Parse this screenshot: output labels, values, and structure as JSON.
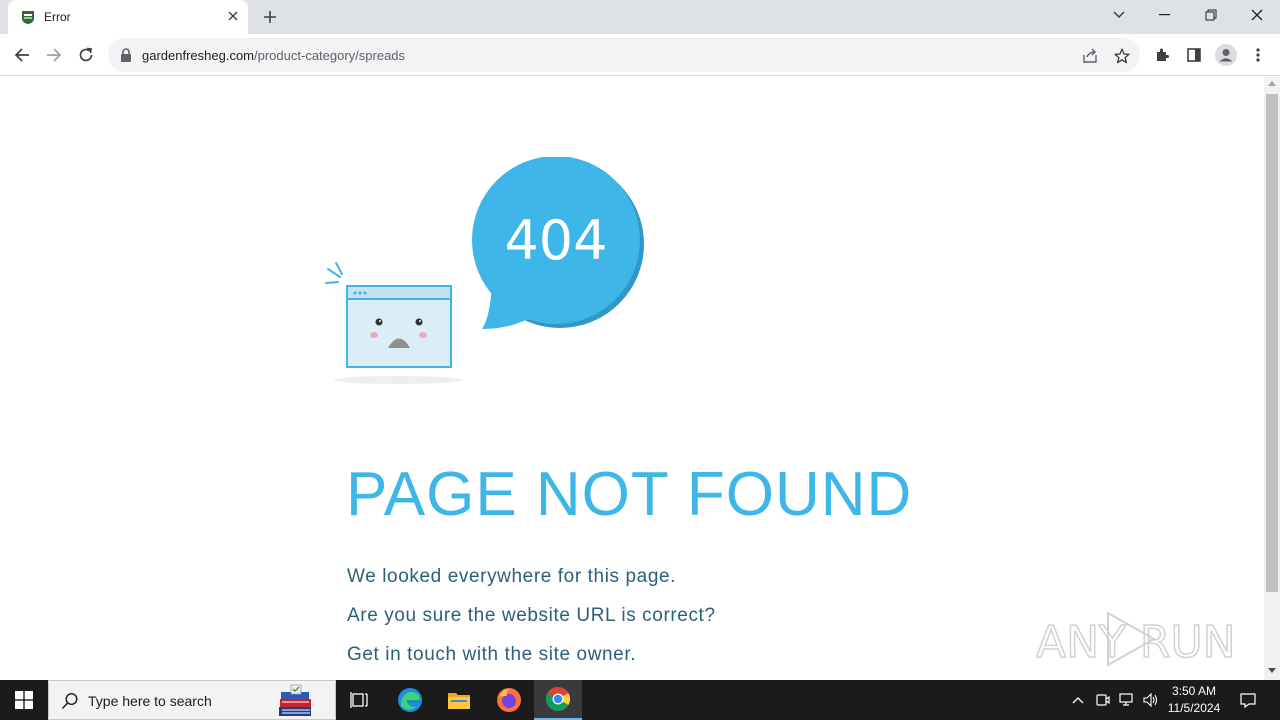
{
  "browser": {
    "tab_title": "Error",
    "url_domain": "gardenfresheg.com",
    "url_path": "/product-category/spreads"
  },
  "page": {
    "bubble_text": "404",
    "heading": "PAGE NOT FOUND",
    "lines": [
      "We looked everywhere for this page.",
      "Are you sure the website URL is correct?",
      "Get in touch with the site owner."
    ],
    "watermark": "ANY RUN"
  },
  "taskbar": {
    "search_placeholder": "Type here to search",
    "time": "3:50 AM",
    "date": "11/5/2024"
  },
  "colors": {
    "accent": "#3fb6e8",
    "text": "#2c5f7a"
  }
}
